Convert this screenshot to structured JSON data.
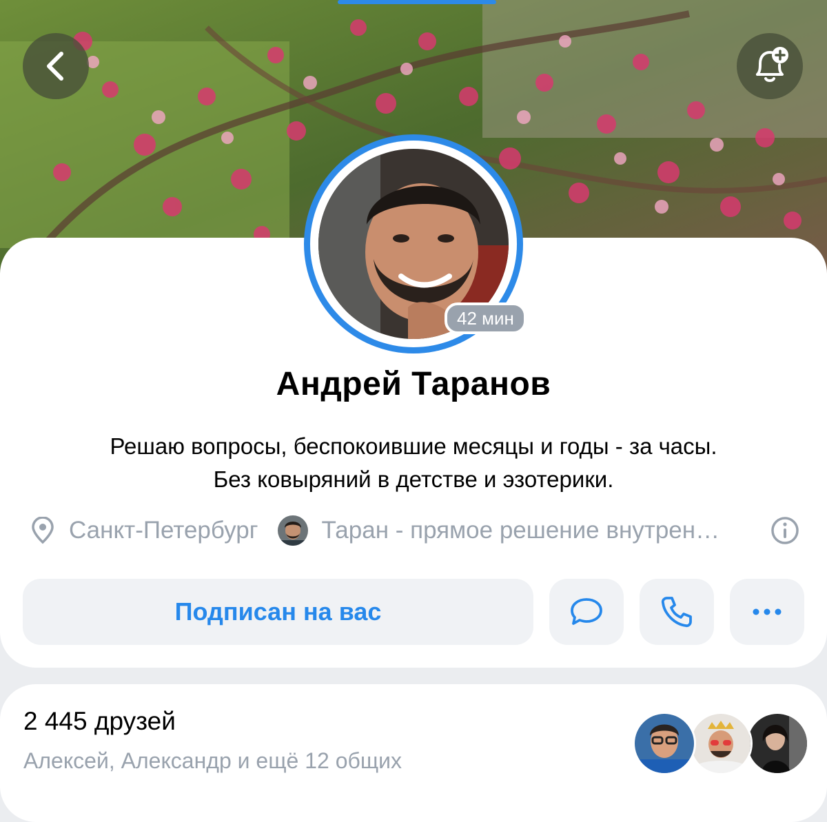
{
  "header": {
    "back_icon": "chevron-left-icon",
    "subscribe_icon": "bell-plus-icon",
    "cover_description": "pink-blossoms-cover"
  },
  "profile": {
    "name": "Андрей Таранов",
    "last_seen_badge": "42 мин",
    "status_line1": "Решаю вопросы, беспокоившие месяцы и годы - за часы.",
    "status_line2": "Без ковыряний в детстве и эзотерики.",
    "city": "Санкт-Петербург",
    "work": "Таран - прямое решение внутренних проблем",
    "location_icon": "map-pin-icon",
    "info_icon": "info-circle-icon"
  },
  "actions": {
    "subscribed_label": "Подписан на вас",
    "message_icon": "message-bubble-icon",
    "call_icon": "phone-icon",
    "more_icon": "more-dots-icon"
  },
  "friends": {
    "count_label": "2 445 друзей",
    "mutual_label": "Алексей, Александр и ещё 12 общих"
  },
  "colors": {
    "accent": "#2688eb",
    "ring": "#2d8ae8",
    "secondary_text": "#99a2ad",
    "button_bg": "#f0f2f5",
    "page_bg": "#ebedf0"
  }
}
